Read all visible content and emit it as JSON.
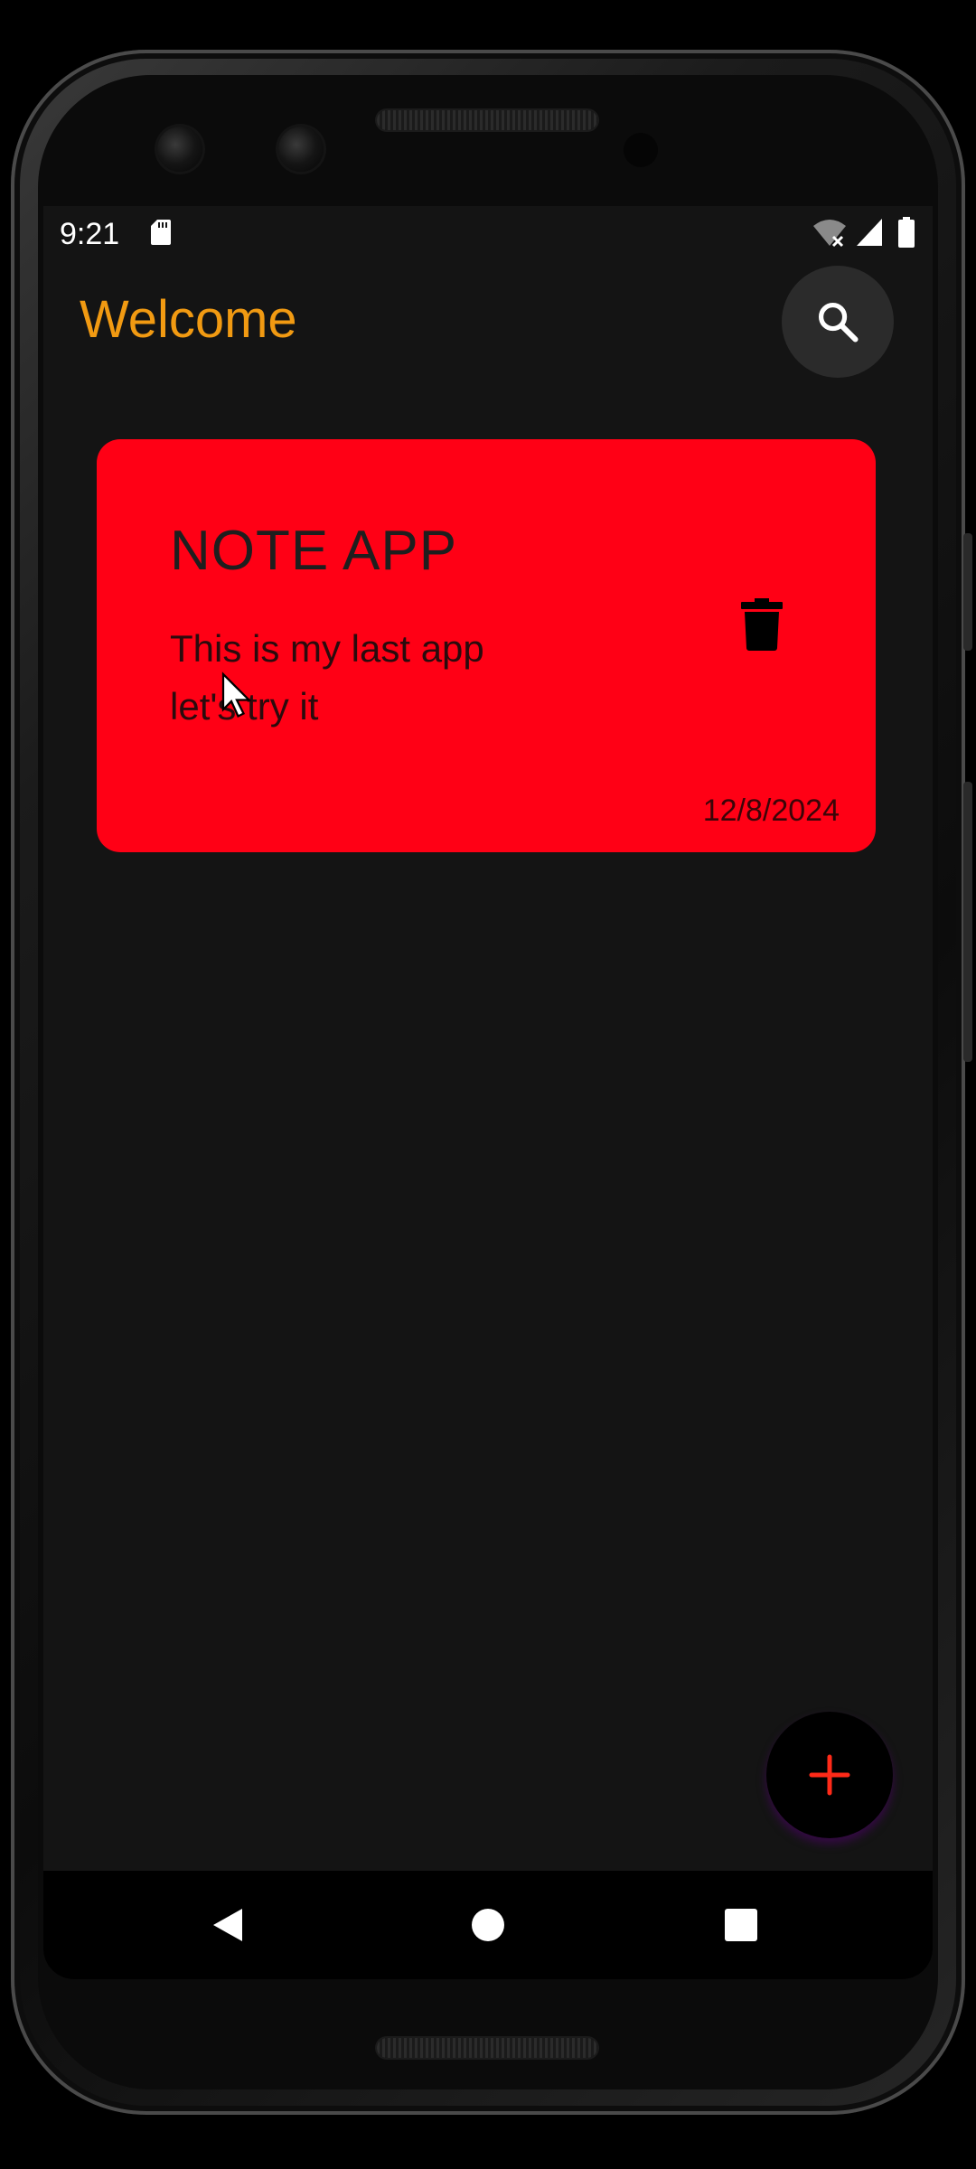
{
  "status_bar": {
    "time": "9:21",
    "icons": [
      "sd-card-icon",
      "wifi-off-icon",
      "cellular-signal-icon",
      "battery-icon"
    ]
  },
  "header": {
    "title": "Welcome",
    "search_icon": "search-icon"
  },
  "notes": [
    {
      "title": "NOTE APP",
      "body": "This is my last app\nlet's try it",
      "date": "12/8/2024",
      "delete_icon": "trash-icon"
    }
  ],
  "fab": {
    "icon": "plus-icon"
  },
  "nav_bar": {
    "buttons": [
      "back-icon",
      "home-icon",
      "recents-icon"
    ]
  },
  "colors": {
    "background": "#141414",
    "title": "#f19a12",
    "card": "#ff0015",
    "fab_plus": "#ff2a18"
  }
}
